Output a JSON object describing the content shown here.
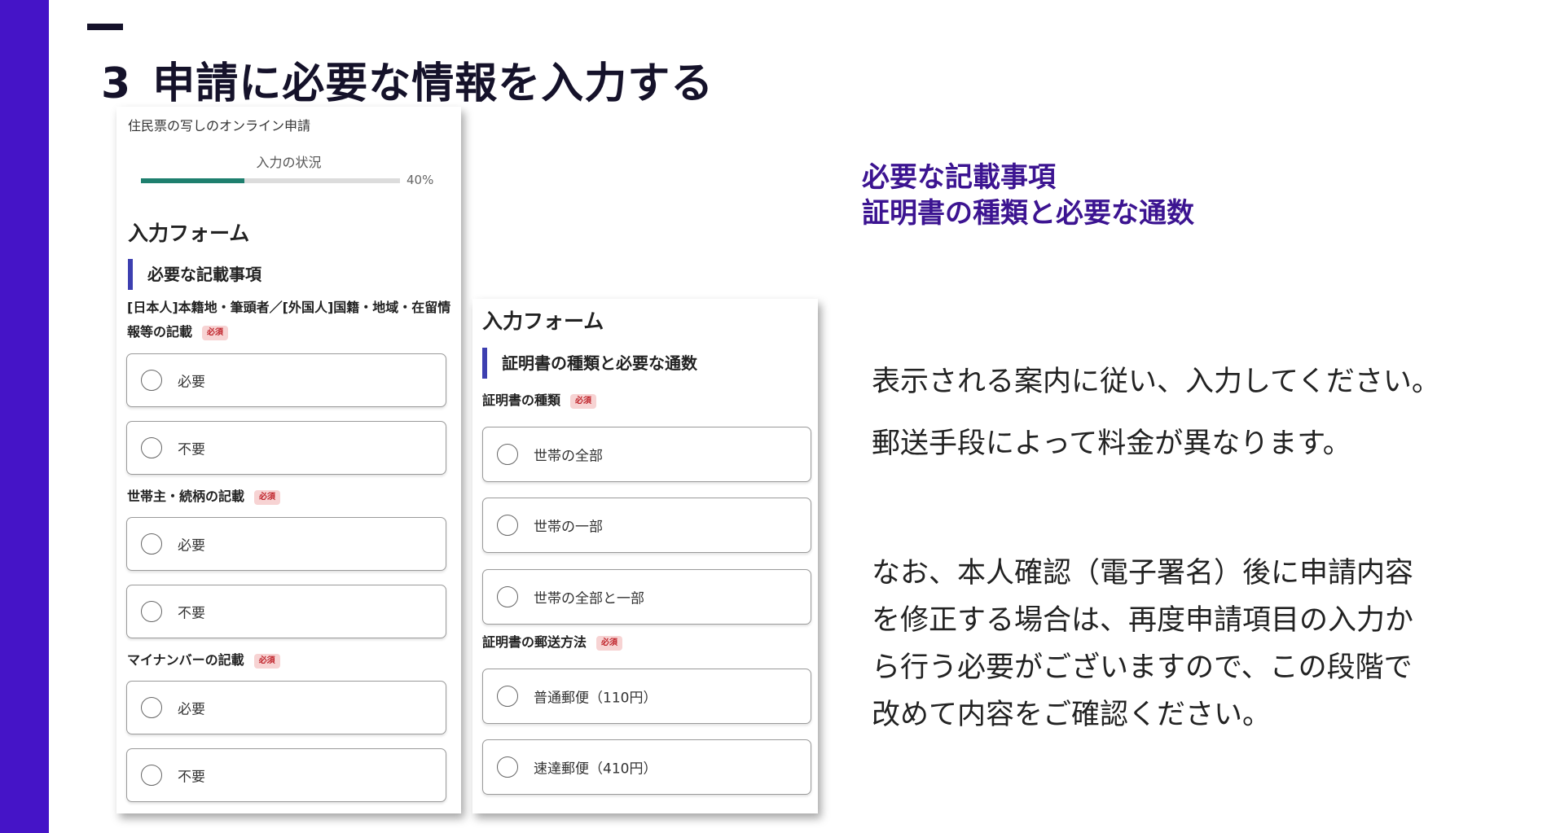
{
  "slide": {
    "number": "3",
    "title": "申請に必要な情報を入力する"
  },
  "colors": {
    "accent_bar": "#4514c7",
    "heading_purple": "#3c1491",
    "progress": "#1e7f6e",
    "section_marker": "#3d3fb0",
    "required_badge_bg": "#f7d3d3",
    "required_badge_text": "#c0262d"
  },
  "screenshot1": {
    "app_title": "住民票の写しのオンライン申請",
    "progress_label": "入力の状況",
    "progress_value": 40,
    "progress_text": "40%",
    "form_heading": "入力フォーム",
    "section_heading": "必要な記載事項",
    "fields": [
      {
        "label": "[日本人]本籍地・筆頭者／[外国人]国籍・地域・在留情報等の記載",
        "required": "必須",
        "options": [
          "必要",
          "不要"
        ]
      },
      {
        "label": "世帯主・続柄の記載",
        "required": "必須",
        "options": [
          "必要",
          "不要"
        ]
      },
      {
        "label": "マイナンバーの記載",
        "required": "必須",
        "options": [
          "必要",
          "不要"
        ]
      }
    ]
  },
  "screenshot2": {
    "form_heading": "入力フォーム",
    "section_heading": "証明書の種類と必要な通数",
    "fields": [
      {
        "label": "証明書の種類",
        "required": "必須",
        "options": [
          "世帯の全部",
          "世帯の一部",
          "世帯の全部と一部"
        ]
      },
      {
        "label": "証明書の郵送方法",
        "required": "必須",
        "options": [
          "普通郵便（110円）",
          "速達郵便（410円）"
        ]
      }
    ]
  },
  "right": {
    "heading_lines": [
      "必要な記載事項",
      "証明書の種類と必要な通数"
    ],
    "paragraph1": "表示される案内に従い、入力してください。",
    "paragraph2": "郵送手段によって料金が異なります。",
    "paragraph3_lines": [
      "なお、本人確認（電子署名）後に申請内容",
      "を修正する場合は、再度申請項目の入力か",
      "ら行う必要がございますので、この段階で",
      "改めて内容をご確認ください。"
    ]
  }
}
